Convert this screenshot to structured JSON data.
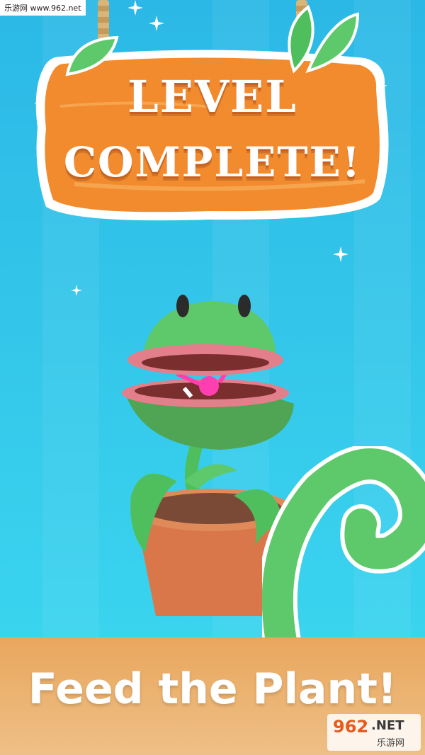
{
  "watermark": {
    "site_label": "乐游网 www.962.net"
  },
  "sign": {
    "line1": "LEVEL",
    "line2": "COMPLETE!"
  },
  "footer": {
    "caption": "Feed the Plant!"
  },
  "logo": {
    "number": "962",
    "suffix": ".NET",
    "chinese": "乐游网"
  },
  "colors": {
    "sky": "#2fc3e6",
    "sign_orange": "#f28a2e",
    "plant_green": "#5ec96a",
    "pot": "#d9774a",
    "footer": "#e9a75d"
  }
}
